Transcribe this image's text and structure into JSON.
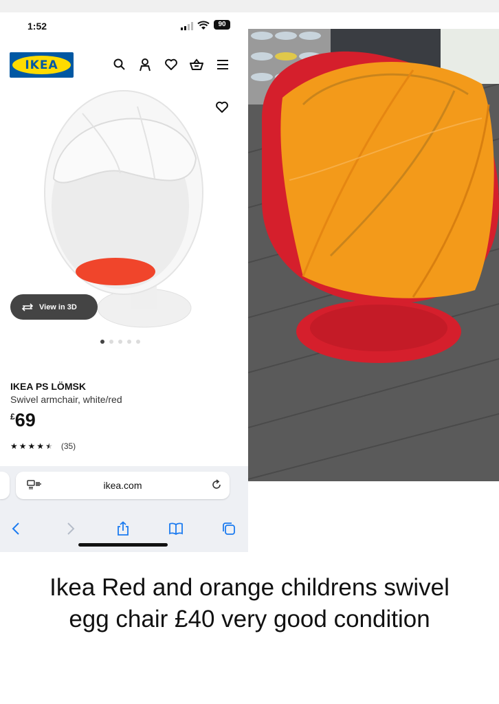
{
  "status": {
    "time": "1:52",
    "battery": "90"
  },
  "brand": {
    "logo_text": "IKEA"
  },
  "nav": {
    "icons": [
      "search-icon",
      "user-icon",
      "heart-icon",
      "basket-icon",
      "menu-icon"
    ]
  },
  "product": {
    "view_3d_label": "View in 3D",
    "name": "IKEA PS LÖMSK",
    "description": "Swivel armchair, white/red",
    "price_currency": "£",
    "price_value": "69",
    "rating": 4.5,
    "rating_count": "(35)",
    "carousel": {
      "total": 5,
      "active": 1
    }
  },
  "browser": {
    "url": "ikea.com"
  },
  "caption": "Ikea Red and orange childrens swivel egg chair £40 very good condition",
  "colors": {
    "ikea_blue": "#0058a3",
    "ikea_yellow": "#ffdb00",
    "cushion_red": "#f0452b",
    "chair_red": "#d51f2c",
    "canopy_orange": "#f39a1a"
  }
}
